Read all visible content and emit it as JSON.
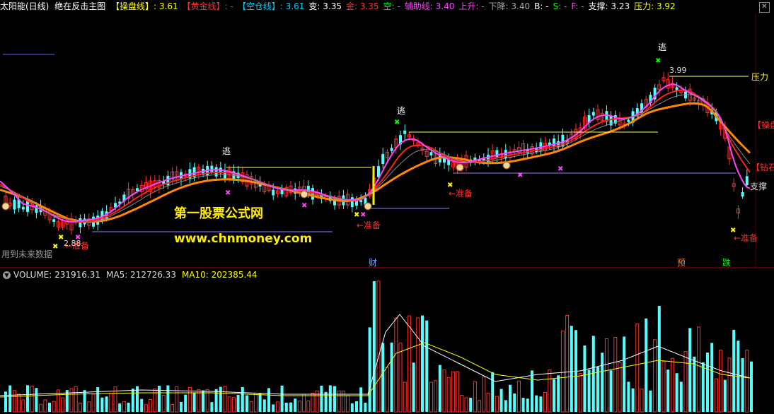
{
  "header": {
    "title": "太阳能(日线)",
    "indicator": "绝在反击主图",
    "items": [
      {
        "label": "【操盘线】",
        "value": ": 3.61",
        "color": "#ffff00"
      },
      {
        "label": "【黄金线】",
        "value": ": -",
        "color": "#ff3030"
      },
      {
        "label": "【空仓线】",
        "value": ": 3.61",
        "color": "#00ccff"
      },
      {
        "label": "变",
        "value": ": 3.35",
        "color": "#ffffff"
      },
      {
        "label": "金",
        "value": ": 3.35",
        "color": "#ff3030"
      },
      {
        "label": "空",
        "value": ": -",
        "color": "#00ff00"
      },
      {
        "label": "辅助线",
        "value": ": 3.40",
        "color": "#ff44ff"
      },
      {
        "label": "上升",
        "value": ": -",
        "color": "#ff44ff"
      },
      {
        "label": "下降",
        "value": ": 3.40",
        "color": "#aaaaaa"
      },
      {
        "label": "B",
        "value": ": -",
        "color": "#ffffff"
      },
      {
        "label": "S",
        "value": ": -",
        "color": "#00ff00"
      },
      {
        "label": "F",
        "value": ": -",
        "color": "#ff44ff"
      },
      {
        "label": "支撑",
        "value": ": 3.23",
        "color": "#ffffff"
      },
      {
        "label": "压力",
        "value": ": 3.92",
        "color": "#ffff00"
      }
    ]
  },
  "price_chart": {
    "annotations": {
      "escape": "逃",
      "prepare": "←准备",
      "high_price": "3.99",
      "low_price": "2.88",
      "pressure": "压力",
      "support": "支撑",
      "caopan_tag": "【操盘",
      "zhuanshi_tag": "【钻石",
      "future_data": "用到未来数据",
      "cai": "财",
      "yu": "预",
      "die": "跌"
    },
    "watermark": {
      "line1": "第一股票公式网",
      "line2": "www.chnmoney.com"
    },
    "colors": {
      "up": "#ff3030",
      "down": "#54ffff",
      "ma_slow": "#ff8800",
      "ma_fast": "#ff44ff",
      "ma_red": "#ff2020",
      "green_line": "#00ff00"
    }
  },
  "volume_panel": {
    "label": "VOLUME: 231916.31",
    "ma5": "MA5: 212726.33",
    "ma10": "MA10: 202385.44"
  },
  "window": {
    "close_icon": "✕"
  }
}
